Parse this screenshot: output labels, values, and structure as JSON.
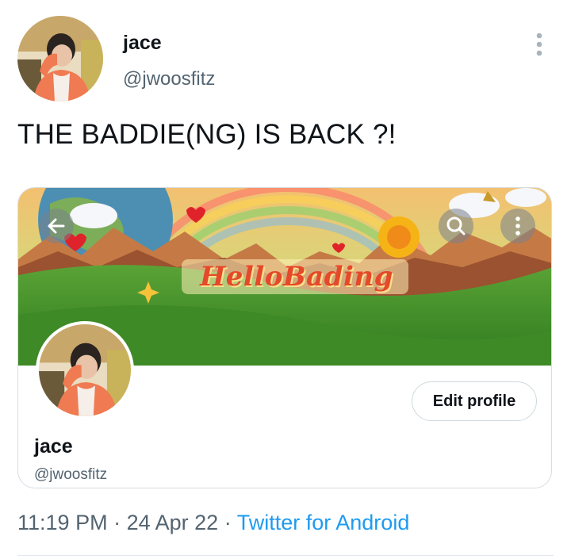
{
  "tweet": {
    "author_name": "jace",
    "author_handle": "@jwoosfitz",
    "text": "THE BADDIE(NG) IS BACK ?!",
    "time": "11:19 PM",
    "separator": "·",
    "date": "24 Apr 22",
    "source": "Twitter for Android"
  },
  "card": {
    "banner_logo_text": "HelloBading",
    "edit_button_label": "Edit profile",
    "profile_name": "jace",
    "profile_handle": "@jwoosfitz"
  },
  "icons": {
    "more": "vertical-ellipsis-icon",
    "back": "arrow-left-icon",
    "search": "search-icon",
    "overflow": "vertical-ellipsis-icon"
  },
  "colors": {
    "text": "#0f1419",
    "muted": "#536471",
    "link": "#1d9bf0",
    "border": "#d7dde2"
  }
}
